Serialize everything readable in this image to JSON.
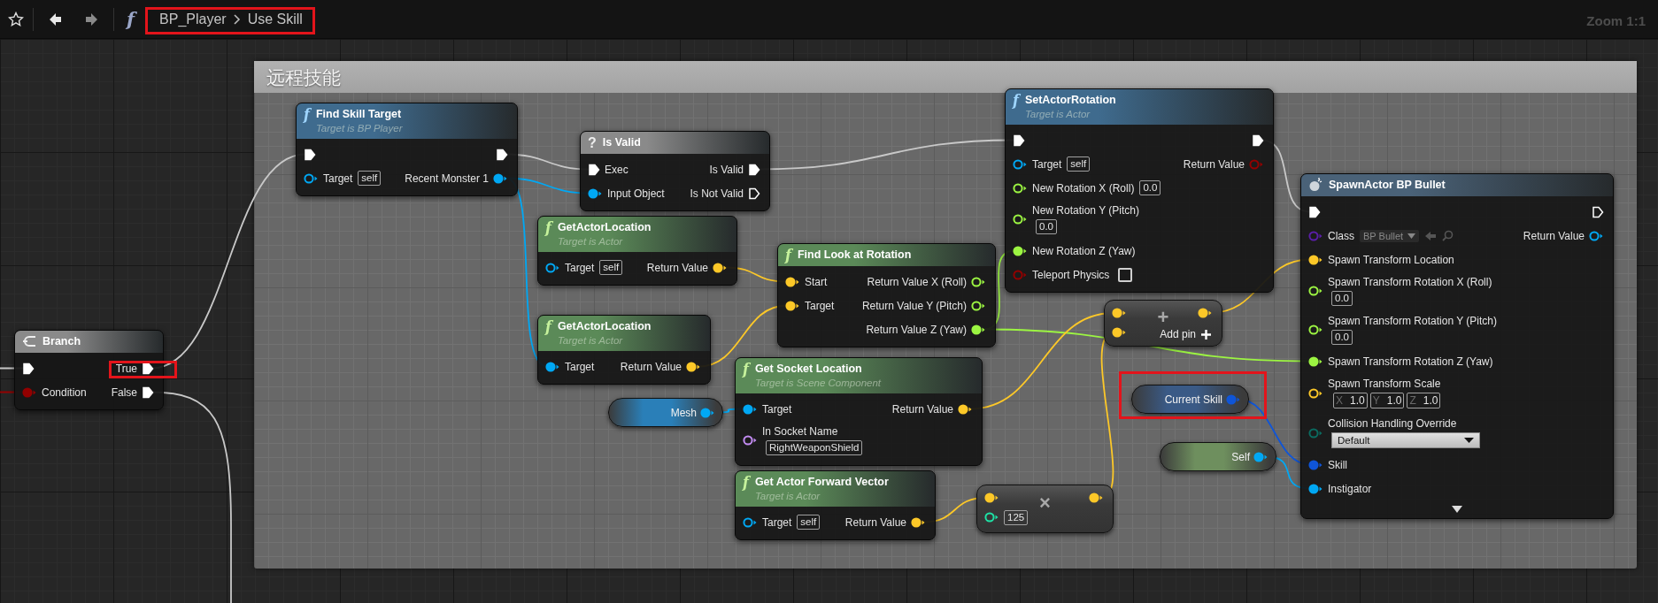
{
  "toolbar": {
    "nav": [
      {
        "kind": "back",
        "disabled": false
      },
      {
        "kind": "forward",
        "disabled": true
      }
    ],
    "icon": "f",
    "breadcrumb": {
      "items": [
        "BP_Player",
        "Use Skill"
      ],
      "highlighted": true
    },
    "zoom": "Zoom 1:1"
  },
  "comment": {
    "title": "远程技能"
  },
  "nodes": [
    {
      "kind": "function",
      "icon": "f",
      "title": "SetActorRotation",
      "subtitle": "Target is Actor",
      "color": "#3f6b8e",
      "rows": [
        {
          "left": {
            "kind": "exec",
            "connected": true
          },
          "right": {
            "kind": "exec",
            "connected": true
          }
        },
        {
          "left": {
            "kind": "data",
            "color": "#00a8f4",
            "connected": false,
            "label": "Target",
            "default": "self"
          },
          "right": {
            "kind": "data",
            "color": "#930000",
            "connected": false,
            "label": "Return Value"
          }
        },
        {
          "left": {
            "kind": "data",
            "color": "#9cf542",
            "connected": false,
            "label": "New Rotation X (Roll)",
            "default": "0.0"
          }
        },
        {
          "left": {
            "kind": "data",
            "color": "#9cf542",
            "connected": false,
            "label": "New Rotation Y (Pitch)",
            "default": "0.0",
            "stacked": true
          }
        },
        {
          "left": {
            "kind": "data",
            "color": "#9cf542",
            "connected": true,
            "label": "New Rotation Z (Yaw)"
          }
        },
        {
          "left": {
            "kind": "data",
            "color": "#930000",
            "connected": false,
            "label": "Teleport Physics",
            "checkbox": {
              "checked": false
            }
          }
        }
      ]
    },
    {
      "kind": "function",
      "icon": "f",
      "title": "Find Skill Target",
      "subtitle": "Target is BP Player",
      "color": "#3f6b8e",
      "rows": [
        {
          "left": {
            "kind": "exec",
            "connected": true
          },
          "right": {
            "kind": "exec",
            "connected": true
          }
        },
        {
          "left": {
            "kind": "data",
            "color": "#00a8f4",
            "connected": false,
            "label": "Target",
            "default": "self"
          },
          "right": {
            "kind": "data",
            "color": "#00a8f4",
            "connected": true,
            "label": "Recent Monster 1"
          }
        }
      ]
    },
    {
      "kind": "macro",
      "icon": "?",
      "title": "Is Valid",
      "color": "#8a8a8a",
      "rows": [
        {
          "left": {
            "kind": "exec",
            "connected": true,
            "label": "Exec"
          },
          "right": {
            "kind": "exec",
            "connected": true,
            "label": "Is Valid"
          }
        },
        {
          "left": {
            "kind": "data",
            "color": "#00a8f4",
            "connected": true,
            "label": "Input Object"
          },
          "right": {
            "kind": "exec",
            "connected": false,
            "label": "Is Not Valid"
          }
        }
      ]
    },
    {
      "kind": "spawn",
      "title": "SpawnActor BP Bullet",
      "color": "#4a6278",
      "collapsed_advanced": true,
      "rows": [
        {
          "left": {
            "kind": "exec",
            "connected": true
          },
          "right": {
            "kind": "exec",
            "connected": false
          }
        },
        {
          "left": {
            "kind": "data",
            "color": "#5a1ea8",
            "connected": false,
            "label": "Class",
            "dropdown": "BP Bullet"
          },
          "right": {
            "kind": "data",
            "color": "#00a8f4",
            "connected": false,
            "label": "Return Value"
          }
        },
        {
          "left": {
            "kind": "data",
            "color": "#fdc828",
            "connected": true,
            "label": "Spawn Transform Location"
          }
        },
        {
          "left": {
            "kind": "data",
            "color": "#9cf542",
            "connected": false,
            "label": "Spawn Transform Rotation X (Roll)",
            "default": "0.0",
            "stacked": true
          }
        },
        {
          "left": {
            "kind": "data",
            "color": "#9cf542",
            "connected": false,
            "label": "Spawn Transform Rotation Y (Pitch)",
            "default": "0.0",
            "stacked": true
          }
        },
        {
          "left": {
            "kind": "data",
            "color": "#9cf542",
            "connected": true,
            "label": "Spawn Transform Rotation Z (Yaw)"
          }
        },
        {
          "left": {
            "kind": "data",
            "color": "#fdc828",
            "connected": false,
            "label": "Spawn Transform Scale",
            "stacked": true,
            "vector": [
              {
                "axis": "X",
                "value": "1.0"
              },
              {
                "axis": "Y",
                "value": "1.0"
              },
              {
                "axis": "Z",
                "value": "1.0"
              }
            ]
          }
        },
        {
          "left": {
            "kind": "data",
            "color": "#0b6b60",
            "connected": false,
            "label": "Collision Handling Override",
            "stacked": true,
            "select": "Default"
          }
        },
        {
          "left": {
            "kind": "data",
            "color": "#0f55d8",
            "connected": true,
            "label": "Skill"
          }
        },
        {
          "left": {
            "kind": "data",
            "color": "#00a8f4",
            "connected": true,
            "label": "Instigator"
          }
        }
      ]
    },
    {
      "kind": "pure",
      "icon": "f",
      "title": "GetActorLocation",
      "subtitle": "Target is Actor",
      "color": "#5b8a58",
      "rows": [
        {
          "left": {
            "kind": "data",
            "color": "#00a8f4",
            "connected": false,
            "label": "Target",
            "default": "self"
          },
          "right": {
            "kind": "data",
            "color": "#fdc828",
            "connected": true,
            "label": "Return Value"
          }
        }
      ]
    },
    {
      "kind": "pure",
      "icon": "f",
      "title": "Find Look at Rotation",
      "color": "#5b8a58",
      "rows": [
        {
          "left": {
            "kind": "data",
            "color": "#fdc828",
            "connected": true,
            "label": "Start"
          },
          "right": {
            "kind": "data",
            "color": "#9cf542",
            "connected": false,
            "label": "Return Value X (Roll)"
          }
        },
        {
          "left": {
            "kind": "data",
            "color": "#fdc828",
            "connected": true,
            "label": "Target"
          },
          "right": {
            "kind": "data",
            "color": "#9cf542",
            "connected": false,
            "label": "Return Value Y (Pitch)"
          }
        },
        {
          "right": {
            "kind": "data",
            "color": "#9cf542",
            "connected": true,
            "label": "Return Value Z (Yaw)"
          }
        }
      ]
    },
    {
      "kind": "operator",
      "symbol": "+",
      "add_pin": "Add pin",
      "rows": [
        {
          "left": {
            "kind": "data",
            "color": "#fdc828",
            "connected": true
          },
          "right": {
            "kind": "data",
            "color": "#fdc828",
            "connected": true
          }
        },
        {
          "left": {
            "kind": "data",
            "color": "#fdc828",
            "connected": true
          }
        }
      ]
    },
    {
      "kind": "pure",
      "icon": "f",
      "title": "GetActorLocation",
      "subtitle": "Target is Actor",
      "color": "#5b8a58",
      "rows": [
        {
          "left": {
            "kind": "data",
            "color": "#00a8f4",
            "connected": true,
            "label": "Target"
          },
          "right": {
            "kind": "data",
            "color": "#fdc828",
            "connected": true,
            "label": "Return Value"
          }
        }
      ]
    },
    {
      "kind": "macro",
      "title": "Branch",
      "color": "#8a8a8a",
      "rows": [
        {
          "left": {
            "kind": "exec",
            "connected": true
          },
          "right": {
            "kind": "exec",
            "connected": true,
            "label": "True",
            "highlighted": true
          }
        },
        {
          "left": {
            "kind": "data",
            "color": "#930000",
            "connected": true,
            "label": "Condition"
          },
          "right": {
            "kind": "exec",
            "connected": true,
            "label": "False"
          }
        }
      ]
    },
    {
      "kind": "pure",
      "icon": "f",
      "title": "Get Socket Location",
      "subtitle": "Target is Scene Component",
      "color": "#5b8a58",
      "rows": [
        {
          "left": {
            "kind": "data",
            "color": "#00a8f4",
            "connected": true,
            "label": "Target"
          },
          "right": {
            "kind": "data",
            "color": "#fdc828",
            "connected": true,
            "label": "Return Value"
          }
        },
        {
          "left": {
            "kind": "data",
            "color": "#c38cf2",
            "connected": false,
            "label": "In Socket Name",
            "default": "RightWeaponShield",
            "stacked": true
          }
        }
      ]
    },
    {
      "kind": "variable",
      "title": "Current Skill",
      "color": "#3a5a86",
      "highlighted": true,
      "rows": [
        {
          "right": {
            "kind": "data",
            "color": "#0f55d8",
            "connected": true
          }
        }
      ]
    },
    {
      "kind": "variable",
      "title": "Mesh",
      "color": "#2a7fb8",
      "rows": [
        {
          "right": {
            "kind": "data",
            "color": "#00a8f4",
            "connected": true
          }
        }
      ]
    },
    {
      "kind": "variable",
      "title": "Self",
      "color": "#6e8f5e",
      "rows": [
        {
          "right": {
            "kind": "data",
            "color": "#00a8f4",
            "connected": true
          }
        }
      ]
    },
    {
      "kind": "pure",
      "icon": "f",
      "title": "Get Actor Forward Vector",
      "subtitle": "Target is Actor",
      "color": "#5b8a58",
      "rows": [
        {
          "left": {
            "kind": "data",
            "color": "#00a8f4",
            "connected": false,
            "label": "Target",
            "default": "self"
          },
          "right": {
            "kind": "data",
            "color": "#fdc828",
            "connected": true,
            "label": "Return Value"
          }
        }
      ]
    },
    {
      "kind": "operator",
      "symbol": "×",
      "rows": [
        {
          "left": {
            "kind": "data",
            "color": "#fdc828",
            "connected": true
          },
          "right": {
            "kind": "data",
            "color": "#fdc828",
            "connected": true
          }
        },
        {
          "left": {
            "kind": "data",
            "color": "#1ee3a6",
            "connected": false,
            "default": "125"
          }
        }
      ]
    }
  ]
}
